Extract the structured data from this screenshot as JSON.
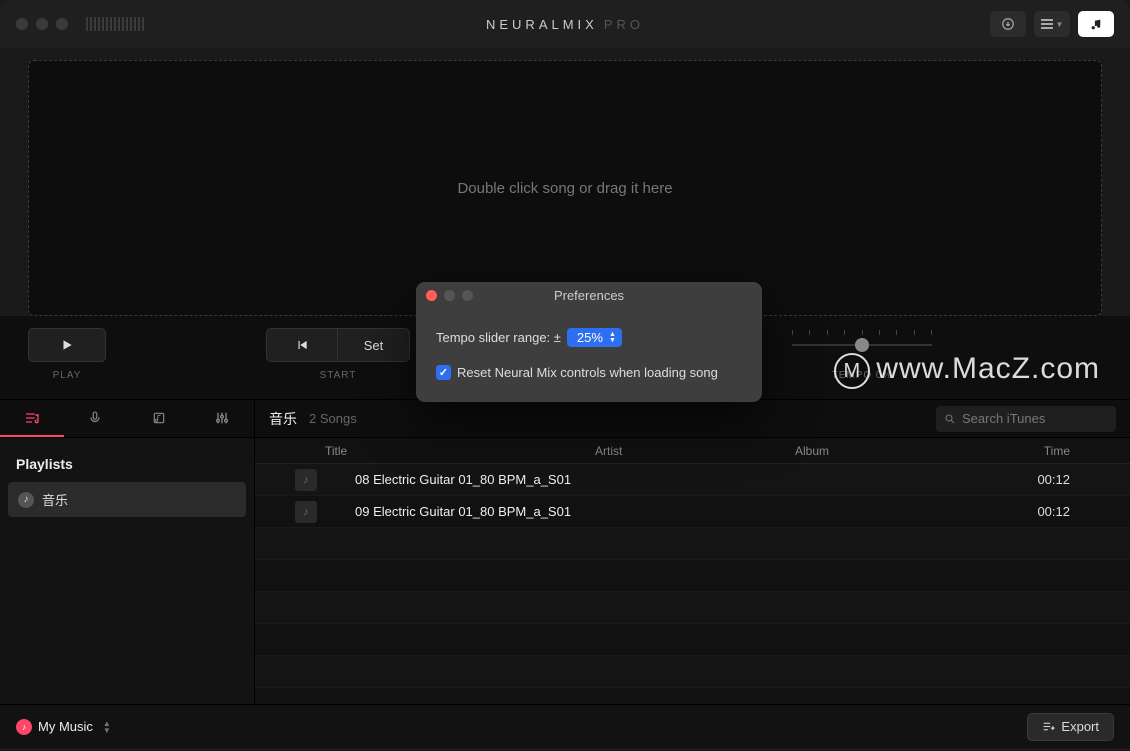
{
  "app": {
    "name": "NEURALMIX",
    "edition": "PRO"
  },
  "dropzone": {
    "message": "Double click song or drag it here"
  },
  "transport": {
    "play_label": "PLAY",
    "start_label": "START",
    "set_label": "Set",
    "tempo_label": "TEMPO 0%"
  },
  "sidebar": {
    "header": "Playlists",
    "items": [
      {
        "label": "音乐",
        "active": true
      }
    ]
  },
  "content": {
    "name": "音乐",
    "count": "2 Songs",
    "search_placeholder": "Search iTunes",
    "columns": {
      "title": "Title",
      "artist": "Artist",
      "album": "Album",
      "time": "Time"
    },
    "rows": [
      {
        "title": "08 Electric Guitar 01_80 BPM_a_S01",
        "artist": "",
        "album": "",
        "time": "00:12"
      },
      {
        "title": "09 Electric Guitar 01_80 BPM_a_S01",
        "artist": "",
        "album": "",
        "time": "00:12"
      }
    ]
  },
  "footer": {
    "source": "My Music",
    "export_label": "Export"
  },
  "prefs": {
    "title": "Preferences",
    "tempo_label": "Tempo slider range: ±",
    "tempo_value": "25%",
    "reset_label": "Reset Neural Mix controls when loading song",
    "reset_checked": true
  },
  "watermark": "www.MacZ.com"
}
